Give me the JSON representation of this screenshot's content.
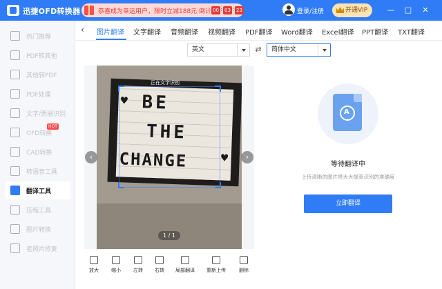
{
  "app": {
    "title": "迅捷OFD转换器"
  },
  "promo": {
    "text": "恭喜成为幸运用户，限时立减188元 倒计时",
    "timer": [
      "00",
      "03",
      "23"
    ]
  },
  "header": {
    "login": "登录/注册",
    "vip": "开通VIP"
  },
  "window_controls": [
    "—",
    "□",
    "✕"
  ],
  "sidebar": {
    "items": [
      {
        "label": "热门推荐",
        "icon": "thumb-icon",
        "active": false
      },
      {
        "label": "PDF转其他",
        "icon": "pdf-export-icon",
        "active": false
      },
      {
        "label": "其他转PDF",
        "icon": "pdf-import-icon",
        "active": false
      },
      {
        "label": "PDF处理",
        "icon": "pdf-process-icon",
        "active": false
      },
      {
        "label": "文字/票据识别",
        "icon": "ocr-icon",
        "active": false
      },
      {
        "label": "OFD转换",
        "icon": "ofd-icon",
        "active": false,
        "badge": "HOT"
      },
      {
        "label": "CAD转换",
        "icon": "cad-icon",
        "active": false
      },
      {
        "label": "转语音工具",
        "icon": "voice-icon",
        "active": false
      },
      {
        "label": "翻译工具",
        "icon": "translate-icon",
        "active": true
      },
      {
        "label": "压缩工具",
        "icon": "compress-icon",
        "active": false
      },
      {
        "label": "图片转换",
        "icon": "image-icon",
        "active": false
      },
      {
        "label": "老照片修复",
        "icon": "photo-repair-icon",
        "active": false
      }
    ]
  },
  "tabs": [
    {
      "label": "图片翻译",
      "active": true
    },
    {
      "label": "文字翻译",
      "active": false
    },
    {
      "label": "音频翻译",
      "active": false
    },
    {
      "label": "视频翻译",
      "active": false
    },
    {
      "label": "PDF翻译",
      "active": false
    },
    {
      "label": "Word翻译",
      "active": false
    },
    {
      "label": "Excel翻译",
      "active": false
    },
    {
      "label": "PPT翻译",
      "active": false
    },
    {
      "label": "TXT翻译",
      "active": false
    }
  ],
  "language": {
    "source": "英文",
    "target": "简体中文"
  },
  "preview": {
    "overlay_label": "正在文字识别",
    "sign_lines": [
      "BE",
      "THE",
      "CHANGE"
    ],
    "page_indicator": "1 / 1"
  },
  "tools": [
    {
      "label": "放大",
      "icon": "zoom-in-icon"
    },
    {
      "label": "缩小",
      "icon": "zoom-out-icon"
    },
    {
      "label": "左转",
      "icon": "rotate-left-icon"
    },
    {
      "label": "右转",
      "icon": "rotate-right-icon"
    },
    {
      "label": "局部翻译",
      "icon": "partial-translate-icon"
    },
    {
      "label": "重新上传",
      "icon": "reupload-icon"
    },
    {
      "label": "删除",
      "icon": "delete-icon"
    }
  ],
  "status": {
    "title": "等待翻译中",
    "subtitle": "上传清晰的图片将大大提高识别的准确度",
    "button": "立即翻译"
  },
  "colors": {
    "accent": "#2f7cf6",
    "promo_red": "#e23b3b",
    "vip_gold": "#fbe3b4"
  }
}
